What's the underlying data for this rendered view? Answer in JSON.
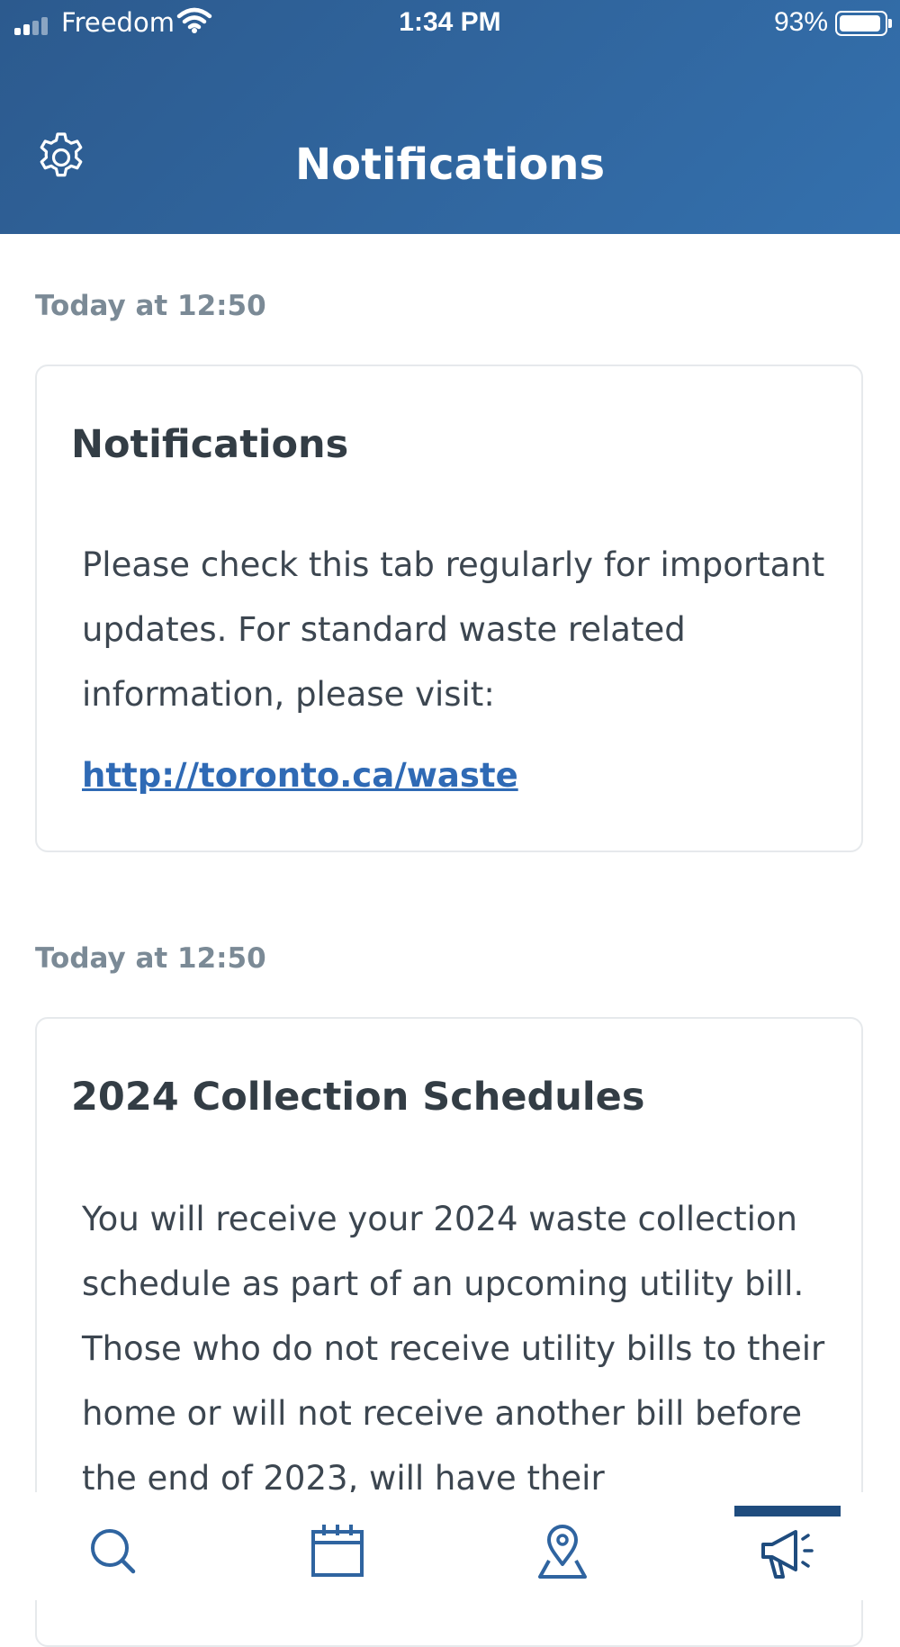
{
  "status_bar": {
    "carrier": "Freedom",
    "time": "1:34 PM",
    "battery_percent": "93%",
    "battery_level": 0.93
  },
  "header": {
    "title": "Notifications",
    "settings_icon": "gear-icon",
    "background_color": "#2f64a0"
  },
  "notifications": [
    {
      "timestamp": "Today at 12:50",
      "title": "Notifications",
      "body": "Please check this tab regularly for important updates. For standard waste related information, please visit:",
      "link": "http://toronto.ca/waste"
    },
    {
      "timestamp": "Today at 12:50",
      "title": "2024 Collection Schedules",
      "body": "You will receive your 2024 waste collection schedule as part of an upcoming utility bill. Those who do not receive utility bills to their home or will not receive another bill before the end of 2023, will have their"
    }
  ],
  "bottom_nav": {
    "items": [
      {
        "icon": "search-icon"
      },
      {
        "icon": "calendar-icon"
      },
      {
        "icon": "map-pin-icon"
      },
      {
        "icon": "megaphone-icon",
        "active": true
      }
    ],
    "accent_color": "#1f4c7e"
  }
}
